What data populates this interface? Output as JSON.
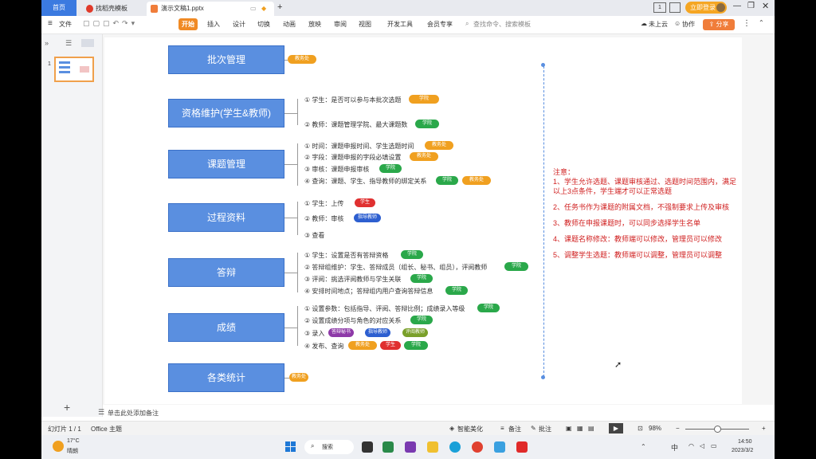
{
  "tabs": {
    "home": "首页",
    "template": "找稻壳模板",
    "doc": "演示文稿1.pptx",
    "plus": "+"
  },
  "window": {
    "login": "立即登录"
  },
  "menu": {
    "file": "文件",
    "start": "开始",
    "items": [
      "插入",
      "设计",
      "切换",
      "动画",
      "放映",
      "审阅",
      "视图",
      "开发工具",
      "会员专享"
    ],
    "search": "查找命令、搜索模板",
    "cloud": "未上云",
    "collab": "协作",
    "share": "分享"
  },
  "slide_number": "1",
  "mindmap": {
    "main": [
      "批次管理",
      "资格维护(学生&教师)",
      "课题管理",
      "过程资料",
      "答辩",
      "成绩",
      "各类统计"
    ],
    "batch_tag": "教务处",
    "qual": {
      "i1": "① 学生：是否可以参与本批次选题",
      "t1": "学院",
      "i2": "② 教师：课题管理学院、最大课题数",
      "t2": "学院"
    },
    "topic": {
      "i1": "① 时间：课题申报时间、学生选题时间",
      "t1": "教务处",
      "i2": "② 字段：课题申报的字段必填设置",
      "t2": "教务处",
      "i3": "③ 审核：课题申报审核",
      "t3": "学院",
      "i4": "④ 查询：课题、学生、指导教师的绑定关系",
      "t4a": "学院",
      "t4b": "教务处"
    },
    "process": {
      "i1": "① 学生：上传",
      "t1": "学生",
      "i2": "② 教师：审核",
      "t2": "指导教师",
      "i3": "③ 查看"
    },
    "defense": {
      "i1": "① 学生：设置是否有答辩资格",
      "t1": "学院",
      "i2": "② 答辩组维护：学生、答辩成员（组长、秘书、组员），评阅教师",
      "t2": "学院",
      "i3": "③ 评阅：挑选评阅教师与学生关联",
      "t3": "学院",
      "i4": "④ 安排时间地点；答辩组内用户查询答辩信息",
      "t4": "学院"
    },
    "score": {
      "i1": "① 设置参数：包括指导、评阅、答辩比例；成绩录入等级",
      "t1": "学院",
      "i2": "② 设置成绩分项与角色的对应关系",
      "t2": "学院",
      "i3": "③ 录入",
      "t3a": "答辩秘书",
      "t3b": "指导教师",
      "t3c": "评阅教师",
      "i4": "④ 发布、查询",
      "t4a": "教务处",
      "t4b": "学生",
      "t4c": "学院"
    },
    "stats_tag": "教务处"
  },
  "notes": {
    "title": "注意：",
    "n1": "1、学生允许选题、课题审核通过、选题时间范围内，满足以上3点条件，学生端才可以正常选题",
    "n2": "2、任务书作为课题的附属文档，不强制要求上传及审核",
    "n3": "3、教师在申报课题时，可以同步选择学生名单",
    "n4": "4、课题名称修改：教师端可以修改，管理员可以修改",
    "n5": "5、调整学生选题：教师端可以调整，管理员可以调整"
  },
  "notes_bar": "单击此处添加备注",
  "status": {
    "slide": "幻灯片 1 / 1",
    "theme": "Office 主题",
    "beautify": "智能美化",
    "notes": "备注",
    "comment": "批注",
    "zoom": "98%"
  },
  "taskbar": {
    "temp": "17°C",
    "weather": "晴朗",
    "search": "搜索",
    "lang": "中",
    "time": "14:50",
    "date": "2023/3/2"
  },
  "colors": {
    "main_box": "#5a8fe0",
    "accent_orange": "#f08a24",
    "notes_red": "#d02020"
  }
}
